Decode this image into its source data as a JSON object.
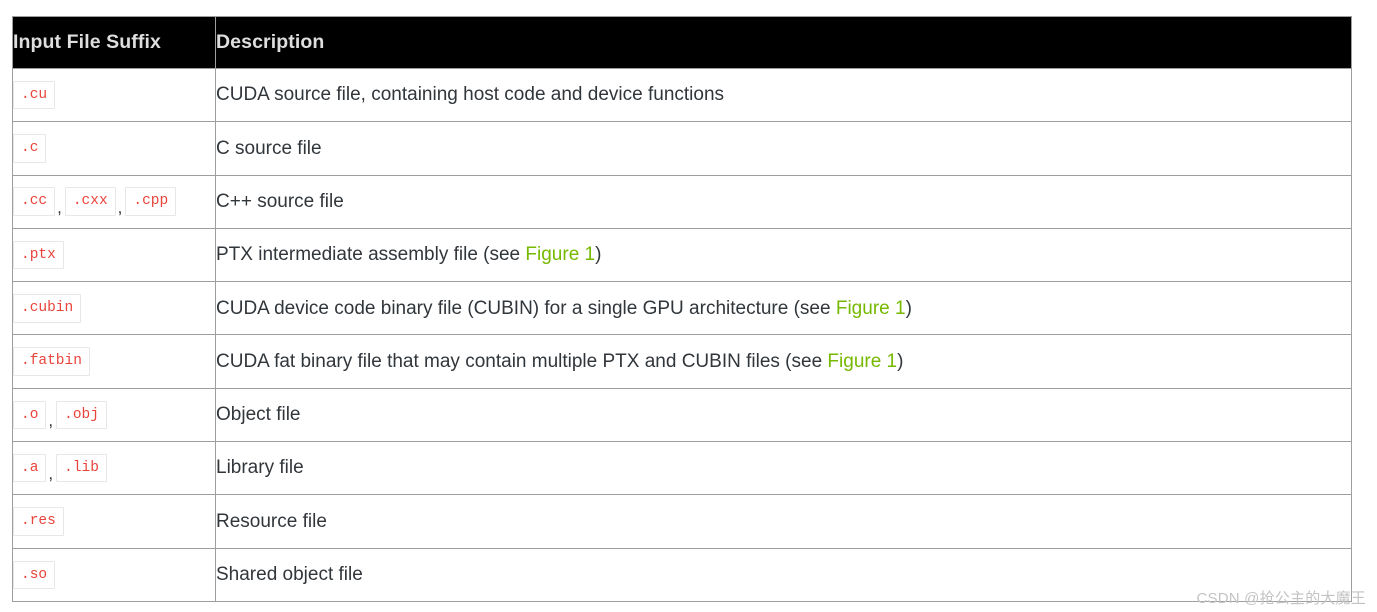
{
  "table": {
    "headers": {
      "suffix": "Input File Suffix",
      "description": "Description"
    },
    "rows": [
      {
        "badges": [
          ".cu"
        ],
        "desc_prefix": "CUDA source file, containing host code and device functions",
        "link": "",
        "desc_suffix": ""
      },
      {
        "badges": [
          ".c"
        ],
        "desc_prefix": "C source file",
        "link": "",
        "desc_suffix": ""
      },
      {
        "badges": [
          ".cc",
          ".cxx",
          ".cpp"
        ],
        "desc_prefix": "C++ source file",
        "link": "",
        "desc_suffix": ""
      },
      {
        "badges": [
          ".ptx"
        ],
        "desc_prefix": "PTX intermediate assembly file (see ",
        "link": "Figure 1",
        "desc_suffix": ")"
      },
      {
        "badges": [
          ".cubin"
        ],
        "desc_prefix": "CUDA device code binary file (CUBIN) for a single GPU architecture (see ",
        "link": "Figure 1",
        "desc_suffix": ")"
      },
      {
        "badges": [
          ".fatbin"
        ],
        "desc_prefix": "CUDA fat binary file that may contain multiple PTX and CUBIN files (see ",
        "link": "Figure 1",
        "desc_suffix": ")"
      },
      {
        "badges": [
          ".o",
          ".obj"
        ],
        "desc_prefix": "Object file",
        "link": "",
        "desc_suffix": ""
      },
      {
        "badges": [
          ".a",
          ".lib"
        ],
        "desc_prefix": "Library file",
        "link": "",
        "desc_suffix": ""
      },
      {
        "badges": [
          ".res"
        ],
        "desc_prefix": "Resource file",
        "link": "",
        "desc_suffix": ""
      },
      {
        "badges": [
          ".so"
        ],
        "desc_prefix": "Shared object file",
        "link": "",
        "desc_suffix": ""
      }
    ],
    "badge_separator": ","
  },
  "watermark": {
    "text": "CSDN @抢公主的大魔王"
  },
  "colors": {
    "header_background": "#000000",
    "header_text": "#dedede",
    "body_text": "#31363b",
    "code_text": "#e8443b",
    "code_border": "#e7e7e7",
    "link": "#76b900",
    "table_border": "#9e9e9e",
    "watermark_text": "#c3c3c3"
  }
}
